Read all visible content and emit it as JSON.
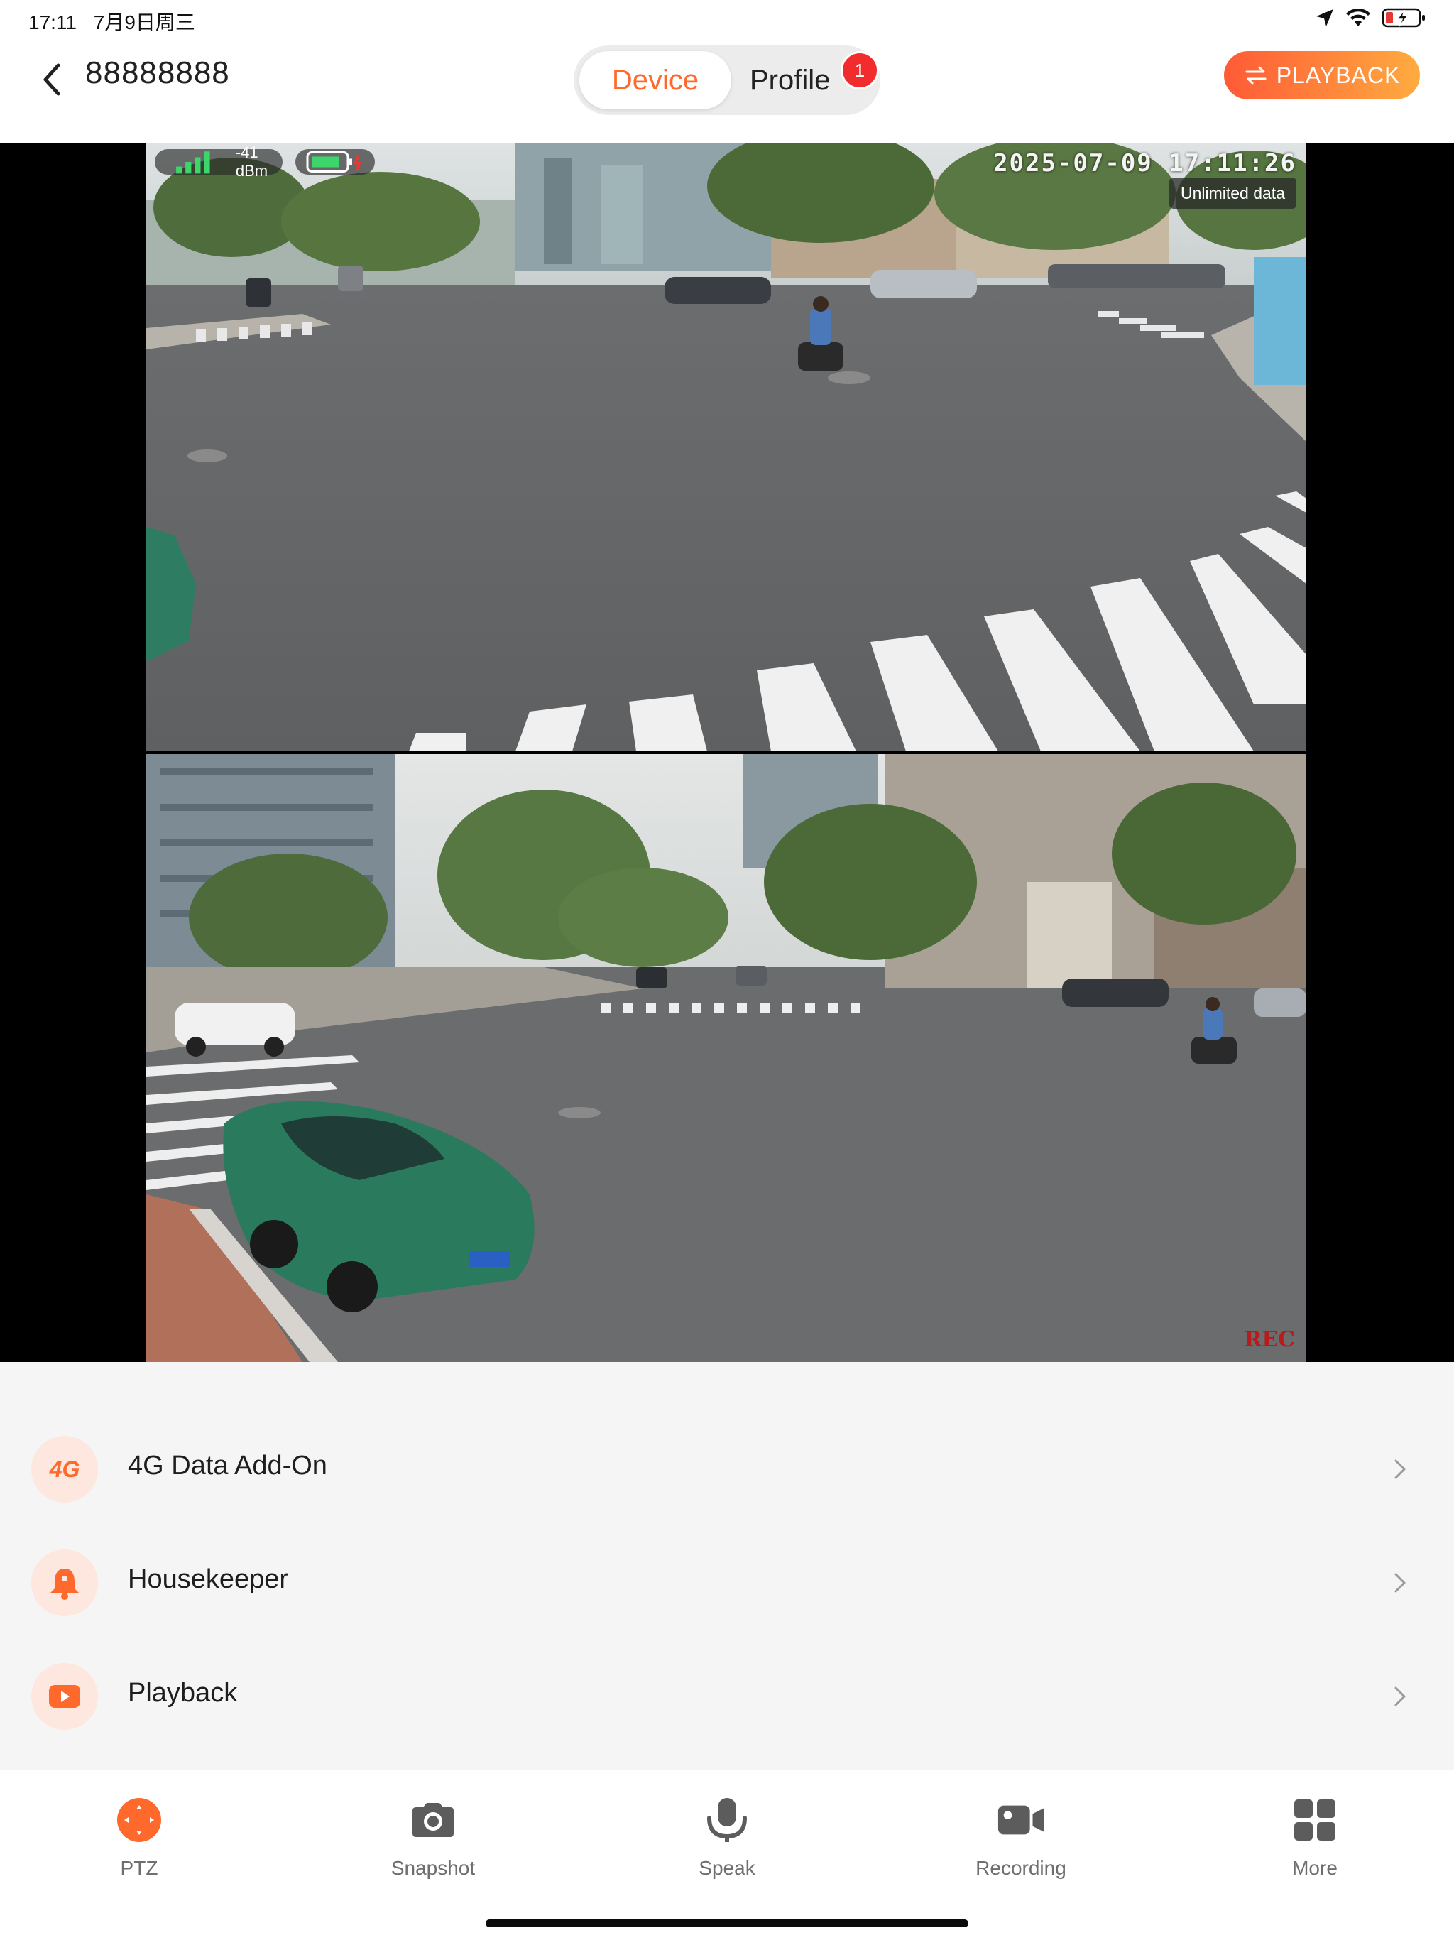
{
  "status_bar": {
    "time": "17:11",
    "date": "7月9日周三",
    "icons": [
      "location-arrow-icon",
      "wifi-icon",
      "battery-charging-icon"
    ]
  },
  "header": {
    "device_name": "88888888",
    "tabs": [
      {
        "label": "Device",
        "active": true
      },
      {
        "label": "Profile",
        "badge": "1"
      }
    ],
    "playback_button": "PLAYBACK",
    "accent": "#ff6a2c"
  },
  "video": {
    "signal": "-41 dBm",
    "timestamp": "2025-07-09 17:11:26",
    "data_plan": "Unlimited data",
    "rec_label": "REC"
  },
  "menu": {
    "items": [
      {
        "label": "4G Data Add-On",
        "icon": "4g-icon",
        "icon_text": "4G"
      },
      {
        "label": "Housekeeper",
        "icon": "bell-icon"
      },
      {
        "label": "Playback",
        "icon": "play-icon"
      }
    ]
  },
  "toolbar": {
    "items": [
      {
        "label": "PTZ",
        "icon": "ptz-icon",
        "active": true
      },
      {
        "label": "Snapshot",
        "icon": "camera-icon"
      },
      {
        "label": "Speak",
        "icon": "microphone-icon"
      },
      {
        "label": "Recording",
        "icon": "video-camera-icon"
      },
      {
        "label": "More",
        "icon": "grid-icon"
      }
    ]
  }
}
